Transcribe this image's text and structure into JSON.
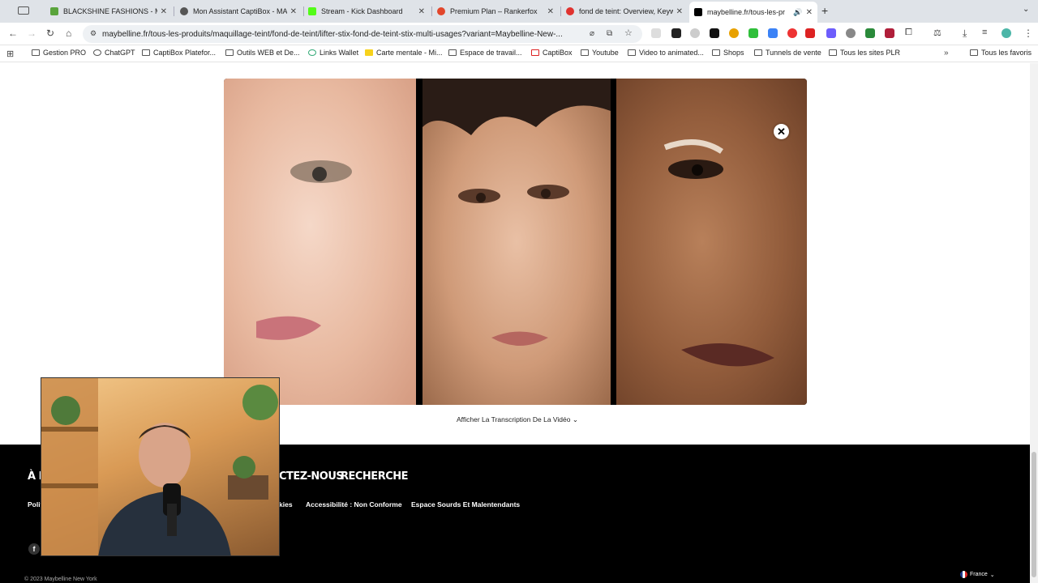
{
  "tabs": [
    {
      "label": "BLACKSHINE FASHIONS - Mo",
      "favicon_color": "#5aa43c"
    },
    {
      "label": "Mon Assistant CaptiBox - MA",
      "favicon_color": "#555555"
    },
    {
      "label": "Stream - Kick Dashboard",
      "favicon_color": "#53fc18"
    },
    {
      "label": "Premium Plan – Rankerfox",
      "favicon_color": "#e2462b"
    },
    {
      "label": "fond de teint: Overview, Keyw",
      "favicon_color": "#e0322f"
    },
    {
      "label": "maybelline.fr/tous-les-pr",
      "favicon_color": "#000000",
      "active": true
    }
  ],
  "address_bar": {
    "url": "maybelline.fr/tous-les-produits/maquillage-teint/fond-de-teint/lifter-stix-fond-de-teint-stix-multi-usages?variant=Maybelline-New-..."
  },
  "bookmarks": [
    "Gestion PRO",
    "ChatGPT",
    "CaptiBox Platefor...",
    "Outils WEB et De...",
    "Links Wallet",
    "Carte mentale - Mi...",
    "Espace de travail...",
    "CaptiBox",
    "Youtube",
    "Video to animated...",
    "Shops",
    "Tunnels de vente",
    "Tous les sites PLR",
    "Tous les favoris"
  ],
  "video": {
    "close_icon": "close-icon",
    "transcript_label": "Afficher La Transcription De La Vidéo ⌄"
  },
  "footer": {
    "headings": [
      "À P",
      "CTEZ-NOUS",
      "RECHERCHE"
    ],
    "links": [
      "Polit",
      "kies",
      "Accessibilité : Non Conforme",
      "Espace Sourds Et Malentendants"
    ],
    "copyright": "© 2023 Maybelline New York",
    "country": "France",
    "social": "f"
  },
  "colors": {
    "tab_strip": "#dfe3e8",
    "footer_bg": "#000000"
  }
}
